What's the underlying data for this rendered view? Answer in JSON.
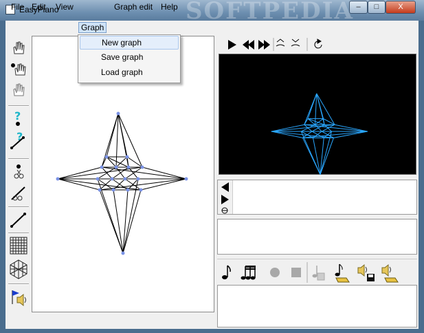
{
  "window": {
    "title": "EasyPiano",
    "watermark": "SOFTPEDIA",
    "min_label": "–",
    "max_label": "□",
    "close_label": "X"
  },
  "menubar": {
    "items": [
      {
        "label": "File"
      },
      {
        "label": "Edit"
      },
      {
        "label": "View"
      },
      {
        "label": "Graph"
      },
      {
        "label": "Graph edit"
      },
      {
        "label": "Help"
      }
    ]
  },
  "graph_menu": {
    "items": [
      {
        "label": "New graph"
      },
      {
        "label": "Save graph"
      },
      {
        "label": "Load graph"
      }
    ]
  },
  "colors": {
    "node": "#7b93e6",
    "edge": "#000000",
    "preview_bg": "#000000",
    "preview_edge": "#2aa7ff"
  },
  "tools": {
    "left": [
      "hand-icon",
      "hand-node-icon",
      "hand-outline-icon",
      "query-node-icon",
      "query-edge-icon",
      "cut-node-icon",
      "cut-edge-icon",
      "line-icon",
      "grid-icon",
      "hexgrid-icon",
      "flag-speaker-icon"
    ]
  },
  "preview_toolbar": [
    "play-icon",
    "rewind-icon",
    "fast-forward-icon",
    "pitch-up-icon",
    "pitch-down-icon",
    "reset-icon"
  ],
  "nav_icons": [
    "arrow-left-icon",
    "arrow-right-icon",
    "small-graph-icon"
  ],
  "music_toolbar": [
    "eighth-note-icon",
    "beamed-notes-icon",
    "record-icon",
    "stop-icon",
    "note-save-disabled-icon",
    "note-load-icon",
    "speaker-save-icon",
    "speaker-load-icon"
  ]
}
